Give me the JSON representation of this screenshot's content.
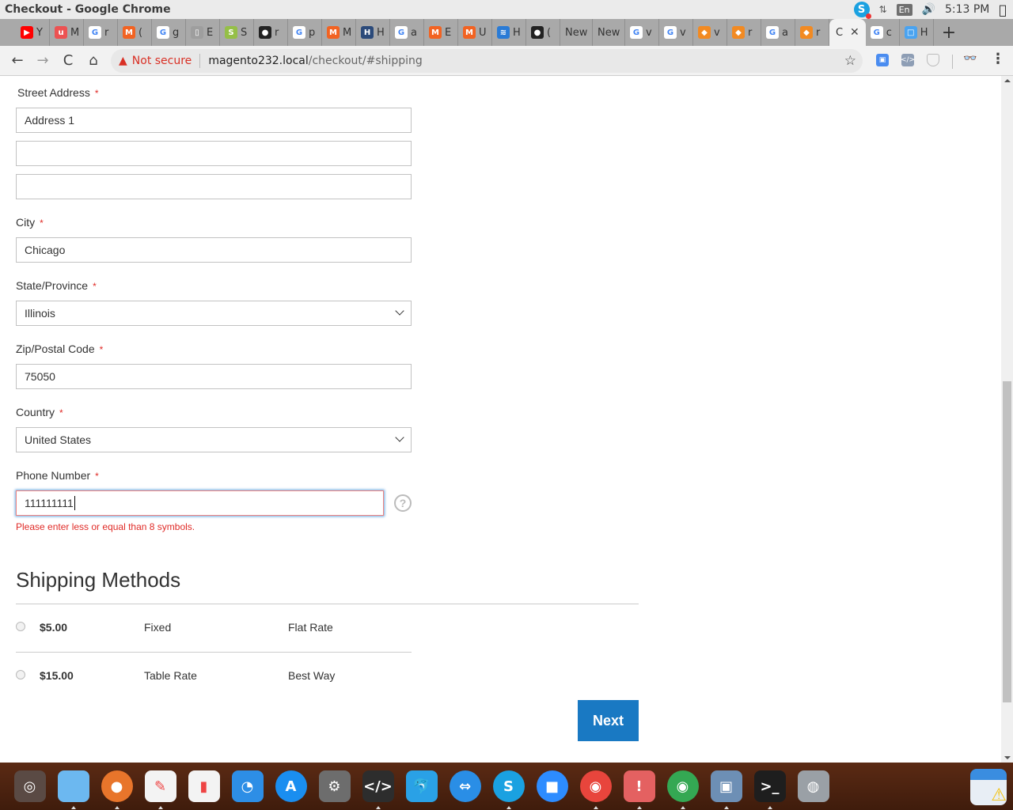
{
  "os": {
    "window_title": "Checkout - Google Chrome",
    "tray": {
      "skype_icon": "S",
      "network_icon": "⇅",
      "language": "En",
      "volume_icon": "🔊",
      "clock": "5:13 PM",
      "apple_icon": ""
    }
  },
  "browser": {
    "tabs": [
      {
        "icon": "youtube",
        "color": "#ff0000",
        "glyph": "▶",
        "label": "Y"
      },
      {
        "icon": "udemy",
        "color": "#ec5252",
        "glyph": "u",
        "label": "M"
      },
      {
        "icon": "google",
        "color": "#4285f4",
        "glyph": "G",
        "label": "r"
      },
      {
        "icon": "magento",
        "color": "#f26322",
        "glyph": "M",
        "label": "("
      },
      {
        "icon": "google",
        "color": "#4285f4",
        "glyph": "G",
        "label": "g"
      },
      {
        "icon": "document",
        "color": "#9e9e9e",
        "glyph": "▯",
        "label": "E"
      },
      {
        "icon": "shopify",
        "color": "#95bf47",
        "glyph": "S",
        "label": "S"
      },
      {
        "icon": "github",
        "color": "#222222",
        "glyph": "●",
        "label": "r"
      },
      {
        "icon": "google",
        "color": "#4285f4",
        "glyph": "G",
        "label": "p"
      },
      {
        "icon": "magento",
        "color": "#f26322",
        "glyph": "M",
        "label": "M"
      },
      {
        "icon": "hfs",
        "color": "#2b4a7a",
        "glyph": "H",
        "label": "H"
      },
      {
        "icon": "google",
        "color": "#4285f4",
        "glyph": "G",
        "label": "a"
      },
      {
        "icon": "magento",
        "color": "#f26322",
        "glyph": "M",
        "label": "E"
      },
      {
        "icon": "magento",
        "color": "#f26322",
        "glyph": "M",
        "label": "U"
      },
      {
        "icon": "site",
        "color": "#2a7bd6",
        "glyph": "≋",
        "label": "H"
      },
      {
        "icon": "github",
        "color": "#222222",
        "glyph": "●",
        "label": "("
      },
      {
        "icon": "none",
        "color": "",
        "glyph": "",
        "label": "New"
      },
      {
        "icon": "none",
        "color": "",
        "glyph": "",
        "label": "New"
      },
      {
        "icon": "google",
        "color": "#4285f4",
        "glyph": "G",
        "label": "v"
      },
      {
        "icon": "google",
        "color": "#4285f4",
        "glyph": "G",
        "label": "v"
      },
      {
        "icon": "magento-cube",
        "color": "#f28a22",
        "glyph": "◆",
        "label": "v"
      },
      {
        "icon": "magento-cube",
        "color": "#f28a22",
        "glyph": "◆",
        "label": "r"
      },
      {
        "icon": "google",
        "color": "#4285f4",
        "glyph": "G",
        "label": "a"
      },
      {
        "icon": "magento-cube",
        "color": "#f28a22",
        "glyph": "◆",
        "label": "r"
      }
    ],
    "active_tab": {
      "label": "C",
      "close_icon": "✕"
    },
    "tabs_after": [
      {
        "icon": "google",
        "color": "#4285f4",
        "glyph": "G",
        "label": "c"
      },
      {
        "icon": "chat",
        "color": "#4aa3f0",
        "glyph": "□",
        "label": "H"
      }
    ],
    "new_tab_icon": "+",
    "nav": {
      "back": "←",
      "forward": "→",
      "reload": "C",
      "home": "⌂"
    },
    "security_warning_icon": "▲",
    "security_label": "Not secure",
    "url_host": "magento232.local",
    "url_path": "/checkout/#shipping",
    "bookmark_icon": "☆",
    "menu_icon": "⋮",
    "incognito_icon": "👓"
  },
  "form": {
    "street": {
      "label": "Street Address",
      "required_mark": "*",
      "line1": "Address 1",
      "line2": "",
      "line3": ""
    },
    "city": {
      "label": "City",
      "required_mark": "*",
      "value": "Chicago"
    },
    "state": {
      "label": "State/Province",
      "required_mark": "*",
      "value": "Illinois"
    },
    "zip": {
      "label": "Zip/Postal Code",
      "required_mark": "*",
      "value": "75050"
    },
    "country": {
      "label": "Country",
      "required_mark": "*",
      "value": "United States"
    },
    "phone": {
      "label": "Phone Number",
      "required_mark": "*",
      "value": "111111111",
      "help_icon": "?",
      "error": "Please enter less or equal than 8 symbols."
    }
  },
  "shipping": {
    "title": "Shipping Methods",
    "methods": [
      {
        "price": "$5.00",
        "method": "Fixed",
        "carrier": "Flat Rate",
        "selected": false
      },
      {
        "price": "$15.00",
        "method": "Table Rate",
        "carrier": "Best Way",
        "selected": false
      }
    ],
    "next_label": "Next"
  },
  "colors": {
    "primary_button": "#1979c3",
    "error": "#e02b27",
    "required": "#e02b27"
  },
  "dock": {
    "apps": [
      {
        "name": "ubuntu",
        "glyph": "◎",
        "bg": "#5a4a44",
        "running": false
      },
      {
        "name": "files",
        "glyph": "",
        "bg": "#6cb8f0",
        "running": true
      },
      {
        "name": "firefox",
        "glyph": "●",
        "bg": "#e8752b",
        "running": true
      },
      {
        "name": "writer",
        "glyph": "✎",
        "bg": "#f3f3f3",
        "running": true
      },
      {
        "name": "calc",
        "glyph": "▮",
        "bg": "#f3f3f3",
        "running": false
      },
      {
        "name": "impress",
        "glyph": "◔",
        "bg": "#2d8ee6",
        "running": false
      },
      {
        "name": "app-store",
        "glyph": "A",
        "bg": "#1a8ef0",
        "running": false
      },
      {
        "name": "settings",
        "glyph": "⚙",
        "bg": "#6d6d6d",
        "running": false
      },
      {
        "name": "sublime",
        "glyph": "</>",
        "bg": "#2d2d2d",
        "running": true
      },
      {
        "name": "mysql-workbench",
        "glyph": "🐬",
        "bg": "#2aa1e6",
        "running": false
      },
      {
        "name": "teamviewer",
        "glyph": "⇔",
        "bg": "#2a8ee6",
        "running": false
      },
      {
        "name": "skype",
        "glyph": "S",
        "bg": "#1aa1e1",
        "running": true
      },
      {
        "name": "zoom",
        "glyph": "■",
        "bg": "#2d8cff",
        "running": false
      },
      {
        "name": "chrome",
        "glyph": "◉",
        "bg": "#e8453c",
        "running": true
      },
      {
        "name": "alert",
        "glyph": "!",
        "bg": "#e46161",
        "running": true
      },
      {
        "name": "chrome-2",
        "glyph": "◉",
        "bg": "#34a853",
        "running": true
      },
      {
        "name": "image-viewer",
        "glyph": "▣",
        "bg": "#6d8fb5",
        "running": true
      },
      {
        "name": "terminal",
        "glyph": ">_",
        "bg": "#1e1e1e",
        "running": true
      },
      {
        "name": "disk",
        "glyph": "◍",
        "bg": "#9aa0a6",
        "running": false
      }
    ],
    "trash_glyph": "⚠"
  }
}
